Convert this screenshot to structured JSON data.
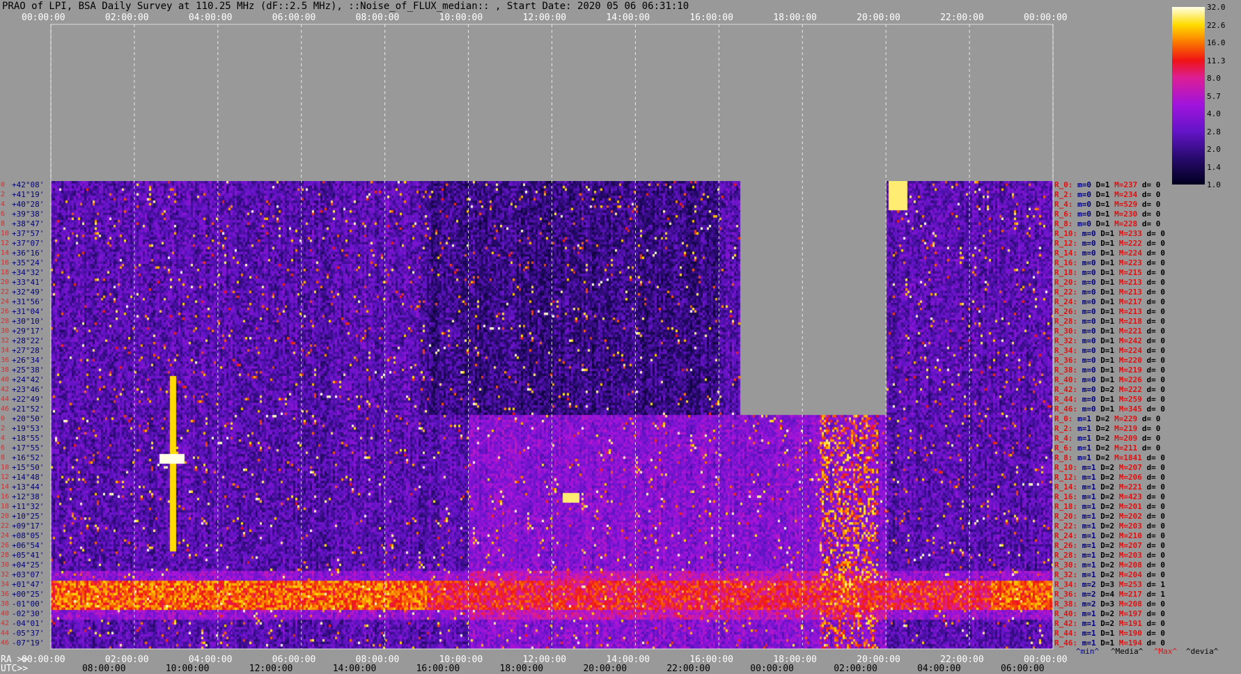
{
  "header": {
    "title": "PRAO of LPI, BSA Daily Survey at 110.25 MHz (dF::2.5 MHz), ::Noise_of_FLUX_median:: , Start Date: 2020 05 06 06:31:10"
  },
  "chart_data": {
    "type": "heatmap",
    "top_time_ticks": [
      "00:00:00",
      "02:00:00",
      "04:00:00",
      "06:00:00",
      "08:00:00",
      "10:00:00",
      "12:00:00",
      "14:00:00",
      "16:00:00",
      "18:00:00",
      "20:00:00",
      "22:00:00",
      "00:00:00"
    ],
    "ra_axis": {
      "label": "RA >>",
      "ticks": [
        "00:00:00",
        "02:00:00",
        "04:00:00",
        "06:00:00",
        "08:00:00",
        "10:00:00",
        "12:00:00",
        "14:00:00",
        "16:00:00",
        "18:00:00",
        "20:00:00",
        "22:00:00",
        "00:00:00"
      ]
    },
    "utc_axis": {
      "label": "UTC>>",
      "ticks": [
        "08:00:00",
        "10:00:00",
        "12:00:00",
        "14:00:00",
        "16:00:00",
        "18:00:00",
        "20:00:00",
        "22:00:00",
        "00:00:00",
        "02:00:00",
        "04:00:00",
        "06:00:00"
      ]
    },
    "declinations": [
      "+42°08'",
      "+41°19'",
      "+40°28'",
      "+39°38'",
      "+38°47'",
      "+37°57'",
      "+37°07'",
      "+36°16'",
      "+35°24'",
      "+34°32'",
      "+33°41'",
      "+32°49'",
      "+31°56'",
      "+31°04'",
      "+30°10'",
      "+29°17'",
      "+28°22'",
      "+27°28'",
      "+26°34'",
      "+25°38'",
      "+24°42'",
      "+23°46'",
      "+22°49'",
      "+21°52'",
      "+20°50'",
      "+19°53'",
      "+18°55'",
      "+17°55'",
      "+16°52'",
      "+15°50'",
      "+14°48'",
      "+13°44'",
      "+12°38'",
      "+11°32'",
      "+10°25'",
      "+09°17'",
      "+08°05'",
      "+06°54'",
      "+05°41'",
      "+04°25'",
      "+03°07'",
      "+01°47'",
      "+00°25'",
      "-01°00'",
      "-02°30'",
      "-04°01'",
      "-05°37'",
      "-07°19'"
    ],
    "row_indices": [
      "0",
      "2",
      "4",
      "6",
      "8",
      "10",
      "12",
      "14",
      "16",
      "18",
      "20",
      "22",
      "24",
      "26",
      "28",
      "30",
      "32",
      "34",
      "36",
      "38",
      "40",
      "42",
      "44",
      "46",
      "0",
      "2",
      "4",
      "6",
      "8",
      "10",
      "12",
      "14",
      "16",
      "18",
      "20",
      "22",
      "24",
      "26",
      "28",
      "30",
      "32",
      "34",
      "36",
      "38",
      "40",
      "42",
      "44",
      "46"
    ],
    "colorbar": {
      "labels": [
        "32.0",
        "22.6",
        "16.0",
        "11.3",
        "8.0",
        "5.7",
        "4.0",
        "2.8",
        "2.0",
        "1.4",
        "1.0"
      ],
      "range": [
        1.0,
        32.0
      ],
      "scale": "log"
    },
    "missing_data_ranges_ra_hours": [
      [
        16.5,
        20.0
      ]
    ],
    "missing_data_rows": "rows 0-23 (upper dec band) missing between RA 16:30 and 20:00",
    "row_stats": [
      {
        "label": "R_0:",
        "m": "m=0",
        "D": "D=1",
        "M": "M=237",
        "d": "d= 0"
      },
      {
        "label": "R_2:",
        "m": "m=0",
        "D": "D=1",
        "M": "M=234",
        "d": "d= 0"
      },
      {
        "label": "R_4:",
        "m": "m=0",
        "D": "D=1",
        "M": "M=529",
        "d": "d= 0"
      },
      {
        "label": "R_6:",
        "m": "m=0",
        "D": "D=1",
        "M": "M=230",
        "d": "d= 0"
      },
      {
        "label": "R_8:",
        "m": "m=0",
        "D": "D=1",
        "M": "M=228",
        "d": "d= 0"
      },
      {
        "label": "R_10:",
        "m": "m=0",
        "D": "D=1",
        "M": "M=233",
        "d": "d= 0"
      },
      {
        "label": "R_12:",
        "m": "m=0",
        "D": "D=1",
        "M": "M=222",
        "d": "d= 0"
      },
      {
        "label": "R_14:",
        "m": "m=0",
        "D": "D=1",
        "M": "M=224",
        "d": "d= 0"
      },
      {
        "label": "R_16:",
        "m": "m=0",
        "D": "D=1",
        "M": "M=223",
        "d": "d= 0"
      },
      {
        "label": "R_18:",
        "m": "m=0",
        "D": "D=1",
        "M": "M=215",
        "d": "d= 0"
      },
      {
        "label": "R_20:",
        "m": "m=0",
        "D": "D=1",
        "M": "M=213",
        "d": "d= 0"
      },
      {
        "label": "R_22:",
        "m": "m=0",
        "D": "D=1",
        "M": "M=213",
        "d": "d= 0"
      },
      {
        "label": "R_24:",
        "m": "m=0",
        "D": "D=1",
        "M": "M=217",
        "d": "d= 0"
      },
      {
        "label": "R_26:",
        "m": "m=0",
        "D": "D=1",
        "M": "M=213",
        "d": "d= 0"
      },
      {
        "label": "R_28:",
        "m": "m=0",
        "D": "D=1",
        "M": "M=218",
        "d": "d= 0"
      },
      {
        "label": "R_30:",
        "m": "m=0",
        "D": "D=1",
        "M": "M=221",
        "d": "d= 0"
      },
      {
        "label": "R_32:",
        "m": "m=0",
        "D": "D=1",
        "M": "M=242",
        "d": "d= 0"
      },
      {
        "label": "R_34:",
        "m": "m=0",
        "D": "D=1",
        "M": "M=224",
        "d": "d= 0"
      },
      {
        "label": "R_36:",
        "m": "m=0",
        "D": "D=1",
        "M": "M=220",
        "d": "d= 0"
      },
      {
        "label": "R_38:",
        "m": "m=0",
        "D": "D=1",
        "M": "M=219",
        "d": "d= 0"
      },
      {
        "label": "R_40:",
        "m": "m=0",
        "D": "D=1",
        "M": "M=226",
        "d": "d= 0"
      },
      {
        "label": "R_42:",
        "m": "m=0",
        "D": "D=2",
        "M": "M=222",
        "d": "d= 0"
      },
      {
        "label": "R_44:",
        "m": "m=0",
        "D": "D=1",
        "M": "M=259",
        "d": "d= 0"
      },
      {
        "label": "R_46:",
        "m": "m=0",
        "D": "D=1",
        "M": "M=345",
        "d": "d= 0"
      },
      {
        "label": "R_0:",
        "m": "m=1",
        "D": "D=2",
        "M": "M=229",
        "d": "d= 0"
      },
      {
        "label": "R_2:",
        "m": "m=1",
        "D": "D=2",
        "M": "M=219",
        "d": "d= 0"
      },
      {
        "label": "R_4:",
        "m": "m=1",
        "D": "D=2",
        "M": "M=209",
        "d": "d= 0"
      },
      {
        "label": "R_6:",
        "m": "m=1",
        "D": "D=2",
        "M": "M=211",
        "d": "d= 0"
      },
      {
        "label": "R_8:",
        "m": "m=1",
        "D": "D=2",
        "M": "M=1841",
        "d": "d= 0"
      },
      {
        "label": "R_10:",
        "m": "m=1",
        "D": "D=2",
        "M": "M=207",
        "d": "d= 0"
      },
      {
        "label": "R_12:",
        "m": "m=1",
        "D": "D=2",
        "M": "M=206",
        "d": "d= 0"
      },
      {
        "label": "R_14:",
        "m": "m=1",
        "D": "D=2",
        "M": "M=221",
        "d": "d= 0"
      },
      {
        "label": "R_16:",
        "m": "m=1",
        "D": "D=2",
        "M": "M=423",
        "d": "d= 0"
      },
      {
        "label": "R_18:",
        "m": "m=1",
        "D": "D=2",
        "M": "M=201",
        "d": "d= 0"
      },
      {
        "label": "R_20:",
        "m": "m=1",
        "D": "D=2",
        "M": "M=202",
        "d": "d= 0"
      },
      {
        "label": "R_22:",
        "m": "m=1",
        "D": "D=2",
        "M": "M=203",
        "d": "d= 0"
      },
      {
        "label": "R_24:",
        "m": "m=1",
        "D": "D=2",
        "M": "M=210",
        "d": "d= 0"
      },
      {
        "label": "R_26:",
        "m": "m=1",
        "D": "D=2",
        "M": "M=207",
        "d": "d= 0"
      },
      {
        "label": "R_28:",
        "m": "m=1",
        "D": "D=2",
        "M": "M=203",
        "d": "d= 0"
      },
      {
        "label": "R_30:",
        "m": "m=1",
        "D": "D=2",
        "M": "M=208",
        "d": "d= 0"
      },
      {
        "label": "R_32:",
        "m": "m=1",
        "D": "D=2",
        "M": "M=204",
        "d": "d= 0"
      },
      {
        "label": "R_34:",
        "m": "m=2",
        "D": "D=3",
        "M": "M=253",
        "d": "d= 1"
      },
      {
        "label": "R_36:",
        "m": "m=2",
        "D": "D=4",
        "M": "M=217",
        "d": "d= 1"
      },
      {
        "label": "R_38:",
        "m": "m=2",
        "D": "D=3",
        "M": "M=208",
        "d": "d= 0"
      },
      {
        "label": "R_40:",
        "m": "m=1",
        "D": "D=2",
        "M": "M=197",
        "d": "d= 0"
      },
      {
        "label": "R_42:",
        "m": "m=1",
        "D": "D=2",
        "M": "M=191",
        "d": "d= 0"
      },
      {
        "label": "R_44:",
        "m": "m=1",
        "D": "D=1",
        "M": "M=190",
        "d": "d= 0"
      },
      {
        "label": "R_46:",
        "m": "m=1",
        "D": "D=1",
        "M": "M=194",
        "d": "d= 0"
      }
    ],
    "stats_legend": {
      "min": "^min^",
      "median": "^Media^",
      "max": "^Max^",
      "deviation": "^devia^"
    }
  },
  "colors": {
    "background": "#999999",
    "grid": "#ffffff",
    "red_text": "#e01010",
    "blue_text": "#00007a"
  }
}
